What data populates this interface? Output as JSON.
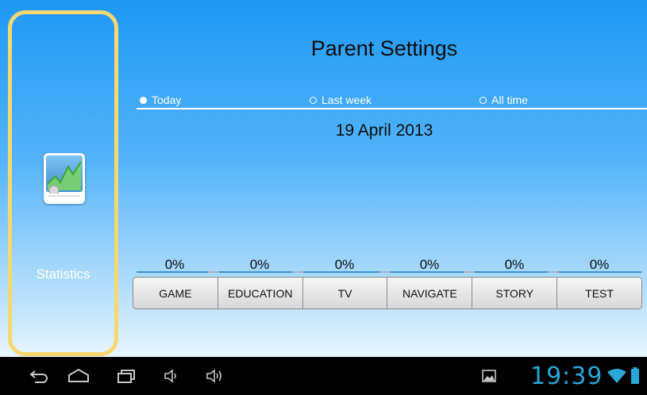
{
  "sidebar": {
    "icon": "chart-icon",
    "label": "Statistics",
    "border_color": "#f5d970"
  },
  "header": {
    "title": "Parent Settings"
  },
  "period_options": [
    {
      "label": "Today",
      "selected": true
    },
    {
      "label": "Last week",
      "selected": false
    },
    {
      "label": "All time",
      "selected": false
    }
  ],
  "date": "19 April 2013",
  "categories": [
    {
      "label": "GAME",
      "percent": "0%"
    },
    {
      "label": "EDUCATION",
      "percent": "0%"
    },
    {
      "label": "TV",
      "percent": "0%"
    },
    {
      "label": "NAVIGATE",
      "percent": "0%"
    },
    {
      "label": "STORY",
      "percent": "0%"
    },
    {
      "label": "TEST",
      "percent": "0%"
    }
  ],
  "system_bar": {
    "icons": [
      "back-icon",
      "home-icon",
      "recents-icon",
      "volume-down-icon",
      "volume-up-icon",
      "gallery-icon",
      "wifi-icon",
      "battery-icon"
    ],
    "clock": "19:39",
    "accent_color": "#2aa6d9"
  }
}
